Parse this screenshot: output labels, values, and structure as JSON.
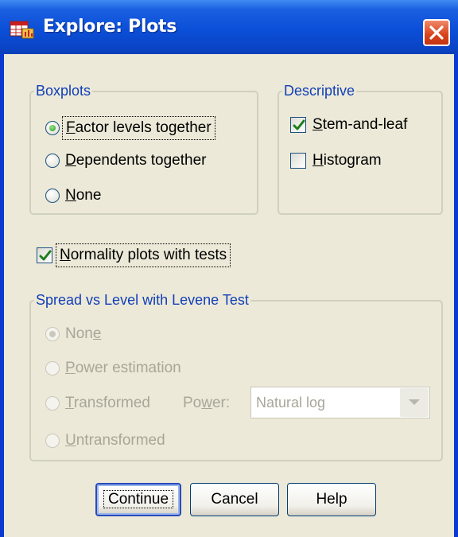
{
  "window": {
    "title": "Explore: Plots",
    "close_label": "close"
  },
  "boxplots": {
    "legend": "Boxplots",
    "options": [
      {
        "label": "Factor levels together",
        "accel": "F",
        "rest": "actor levels together",
        "checked": true
      },
      {
        "label": "Dependents together",
        "accel": "D",
        "rest": "ependents together",
        "checked": false
      },
      {
        "label": "None",
        "accel": "N",
        "rest": "one",
        "checked": false
      }
    ]
  },
  "descriptive": {
    "legend": "Descriptive",
    "stem_and_leaf": {
      "label": "Stem-and-leaf",
      "accel": "S",
      "rest": "tem-and-leaf",
      "checked": true
    },
    "histogram": {
      "label": "Histogram",
      "accel": "H",
      "rest": "istogram",
      "checked": false
    }
  },
  "normality": {
    "label": "Normality plots with tests",
    "accel": "N",
    "rest": "ormality plots with tests",
    "checked": true
  },
  "spread": {
    "legend": "Spread vs Level with Levene Test",
    "options": [
      {
        "label": "None",
        "pre": "Non",
        "accel": "e",
        "post": "",
        "checked": true
      },
      {
        "label": "Power estimation",
        "pre": "",
        "accel": "P",
        "post": "ower estimation",
        "checked": false
      },
      {
        "label": "Transformed",
        "pre": "",
        "accel": "T",
        "post": "ransformed",
        "checked": false
      },
      {
        "label": "Untransformed",
        "pre": "",
        "accel": "U",
        "post": "ntransformed",
        "checked": false
      }
    ],
    "power_label": {
      "label": "Power:",
      "pre": "Po",
      "accel": "w",
      "post": "er:"
    },
    "power_value": "Natural log"
  },
  "buttons": {
    "continue": "Continue",
    "cancel": "Cancel",
    "help": "Help"
  }
}
